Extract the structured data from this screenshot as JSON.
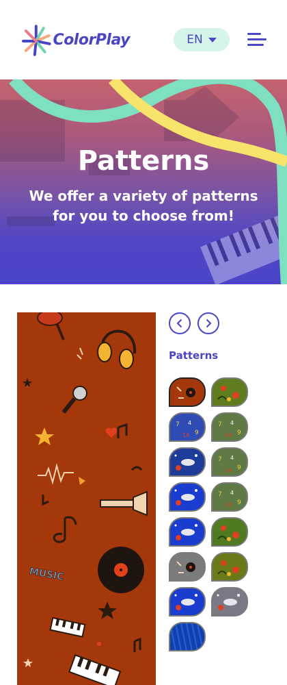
{
  "header": {
    "brand": "ColorPlay",
    "language": "EN"
  },
  "hero": {
    "title": "Patterns",
    "subtitle": "We offer a variety of patterns for you to choose from!"
  },
  "gallery": {
    "label": "Patterns",
    "selected_index": 0,
    "swatches": [
      {
        "theme": "music",
        "color": "#a5380b"
      },
      {
        "theme": "nature-flowers",
        "color": "#5f7d1f"
      },
      {
        "theme": "numbers",
        "color": "#2f4cb5"
      },
      {
        "theme": "numbers",
        "color": "#5f7a44"
      },
      {
        "theme": "space",
        "color": "#1e3d9a"
      },
      {
        "theme": "numbers",
        "color": "#5f7a44"
      },
      {
        "theme": "space",
        "color": "#1a3dd0"
      },
      {
        "theme": "numbers",
        "color": "#5f7a44"
      },
      {
        "theme": "space",
        "color": "#1a3dd0"
      },
      {
        "theme": "nature-flowers",
        "color": "#4f7a1f"
      },
      {
        "theme": "music",
        "color": "#7b7b7b"
      },
      {
        "theme": "nature-flowers",
        "color": "#6a7a1a"
      },
      {
        "theme": "space",
        "color": "#1a3dd0"
      },
      {
        "theme": "space",
        "color": "#7a7a86"
      },
      {
        "theme": "stripes",
        "color": "#1040b0"
      }
    ]
  },
  "preview": {
    "word": "MUSIC"
  },
  "colors": {
    "brand": "#4a45c4",
    "mint": "#d4f5e8",
    "hero_mint": "#7ee0c0",
    "hero_yellow": "#f8e46a",
    "preview_bg": "#a5380b"
  },
  "icons": {
    "logo": "starburst-logo-icon",
    "language": "chevron-down-icon",
    "menu": "menu-icon",
    "prev": "chevron-left-icon",
    "next": "chevron-right-icon"
  }
}
